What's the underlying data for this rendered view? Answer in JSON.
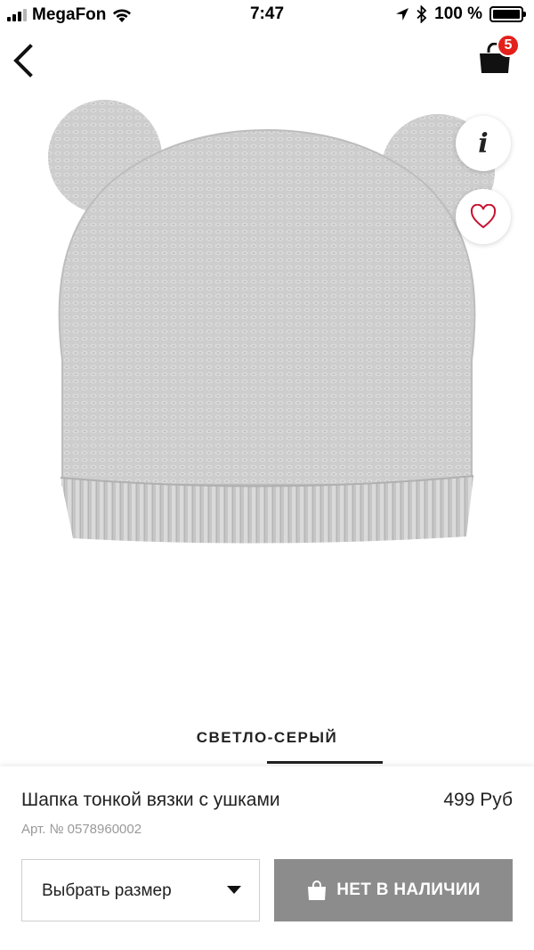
{
  "status_bar": {
    "carrier": "MegaFon",
    "time": "7:47",
    "battery": "100 %"
  },
  "nav": {
    "cart_count": "5"
  },
  "product": {
    "color_name": "СВЕТЛО-СЕРЫЙ",
    "title": "Шапка тонкой вязки с ушками",
    "price": "499 Руб",
    "article_label": "Арт. №",
    "article_number": "0578960002"
  },
  "actions": {
    "size_select_label": "Выбрать размер",
    "stock_button_label": "НЕТ В НАЛИЧИИ",
    "info_glyph": "i"
  },
  "colors": {
    "badge": "#e3201b",
    "heart": "#c8102e",
    "disabled_button": "#8c8c8c",
    "knit": "#cfcfcf"
  }
}
